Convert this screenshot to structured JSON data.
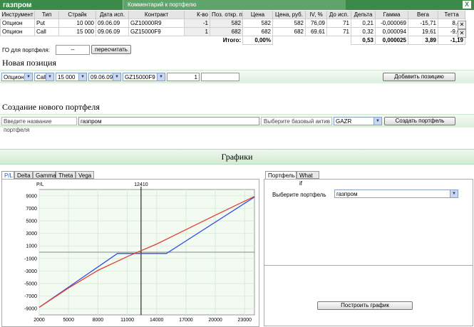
{
  "window": {
    "title": "газпром",
    "comment_label": "Комментарий к портфелю",
    "close": "X"
  },
  "table": {
    "headers": [
      "Инструмент",
      "Тип",
      "Страйк",
      "Дата исп.",
      "Контракт",
      "К-во",
      "Поз. откр. по",
      "Цена",
      "Цена, руб.",
      "IV, %",
      "До исп.",
      "Дельта",
      "Гамма",
      "Вега",
      "Тетта"
    ],
    "rows": [
      [
        "Опцион",
        "Put",
        "10 000",
        "09.06.09",
        "GZ10000R9",
        "-1",
        "582",
        "582",
        "582",
        "76,09",
        "71",
        "0,21",
        "-0,000069",
        "-15,71",
        "8,42"
      ],
      [
        "Опцион",
        "Call",
        "15 000",
        "09.06.09",
        "GZ15000F9",
        "1",
        "682",
        "682",
        "682",
        "69,61",
        "71",
        "0,32",
        "0,000094",
        "19,61",
        "-9,61"
      ]
    ],
    "total_label": "Итого:",
    "total_value": "0,00%",
    "totals": [
      "0,53",
      "0,000025",
      "3,89",
      "-1,19"
    ]
  },
  "go": {
    "label": "ГО для портфеля:",
    "value": "--",
    "recalc_button": "пересчитать"
  },
  "new_position": {
    "title": "Новая позиция",
    "instrument": "Опцион",
    "type": "Call",
    "strike": "15 000",
    "date": "09.06.09",
    "contract": "GZ15000F9",
    "quantity": "1",
    "price": "",
    "add_button": "Добавить позицию"
  },
  "new_portfolio": {
    "title": "Создание нового портфеля",
    "name_label": "Введите название портфеля",
    "name_value": "газпром",
    "asset_label": "Выберите базовый актив",
    "asset_value": "GAZR",
    "create_button": "Создать портфель"
  },
  "graphs": {
    "title": "Графики",
    "tabs": [
      "P/L",
      "Delta",
      "Gamma",
      "Theta",
      "Vega"
    ],
    "right_tabs": [
      "Портфель",
      "What if"
    ],
    "portfolio_label": "Выберите портфель",
    "portfolio_value": "газпром",
    "build_button": "Построить график"
  },
  "chart_data": {
    "type": "line",
    "ylabel": "P/L",
    "marker_label": "12410",
    "marker_x": 12410,
    "xlim": [
      2000,
      24000
    ],
    "ylim": [
      -10000,
      10000
    ],
    "x_ticks": [
      2000,
      5000,
      8000,
      11000,
      14000,
      17000,
      20000,
      23000
    ],
    "y_ticks": [
      9000,
      7000,
      5000,
      3000,
      1000,
      -1000,
      -3000,
      -5000,
      -7000,
      -9000
    ],
    "series": [
      {
        "color": "#3050e0",
        "x": [
          2000,
          10000,
          15000,
          24000
        ],
        "y": [
          -8800,
          -200,
          -200,
          8800
        ]
      },
      {
        "color": "#e04030",
        "x": [
          2000,
          5000,
          8000,
          11000,
          14000,
          17000,
          20000,
          24000
        ],
        "y": [
          -8800,
          -5700,
          -2900,
          -700,
          1300,
          3600,
          5900,
          8900
        ]
      }
    ],
    "colors": {
      "grid": "#d8ecd8",
      "plot_bg": "#f2faf2",
      "marker": "#000000"
    }
  }
}
